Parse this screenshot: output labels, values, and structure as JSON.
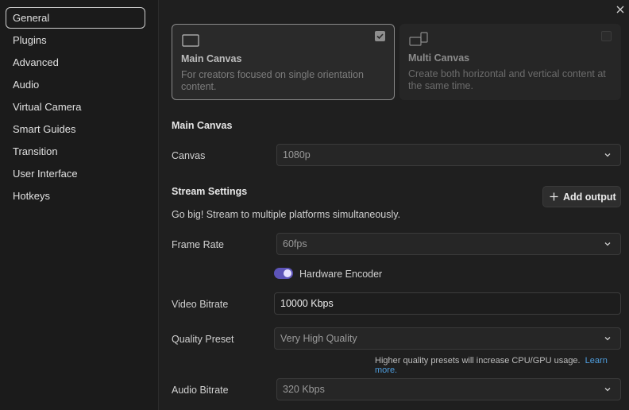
{
  "sidebar": {
    "items": [
      {
        "label": "General"
      },
      {
        "label": "Plugins"
      },
      {
        "label": "Advanced"
      },
      {
        "label": "Audio"
      },
      {
        "label": "Virtual Camera"
      },
      {
        "label": "Smart Guides"
      },
      {
        "label": "Transition"
      },
      {
        "label": "User Interface"
      },
      {
        "label": "Hotkeys"
      }
    ],
    "active": "General"
  },
  "close_icon": "close-icon",
  "canvas_modes": [
    {
      "title": "Main Canvas",
      "description_line1": "For creators focused on single orientation",
      "description_line2": "content.",
      "checked": true
    },
    {
      "title": "Multi Canvas",
      "description_line1": "Create both horizontal and vertical content at",
      "description_line2": "the same time.",
      "checked": false
    }
  ],
  "main_canvas": {
    "section_title": "Main Canvas",
    "canvas_label": "Canvas",
    "canvas_value": "1080p"
  },
  "stream": {
    "section_title": "Stream Settings",
    "add_output_label": "Add output",
    "description": "Go big! Stream to multiple platforms simultaneously.",
    "frame_rate_label": "Frame Rate",
    "frame_rate_value": "60fps",
    "hardware_encoder_label": "Hardware Encoder",
    "hardware_encoder_on": true,
    "video_bitrate_label": "Video Bitrate",
    "video_bitrate_value": "10000 Kbps",
    "quality_preset_label": "Quality Preset",
    "quality_preset_value": "Very High Quality",
    "quality_note": "Higher quality presets will increase CPU/GPU usage.",
    "learn_more": "Learn more.",
    "audio_bitrate_label": "Audio Bitrate",
    "audio_bitrate_value": "320 Kbps"
  },
  "colors": {
    "accent": "#5d54b8",
    "link": "#4f9fe0"
  }
}
